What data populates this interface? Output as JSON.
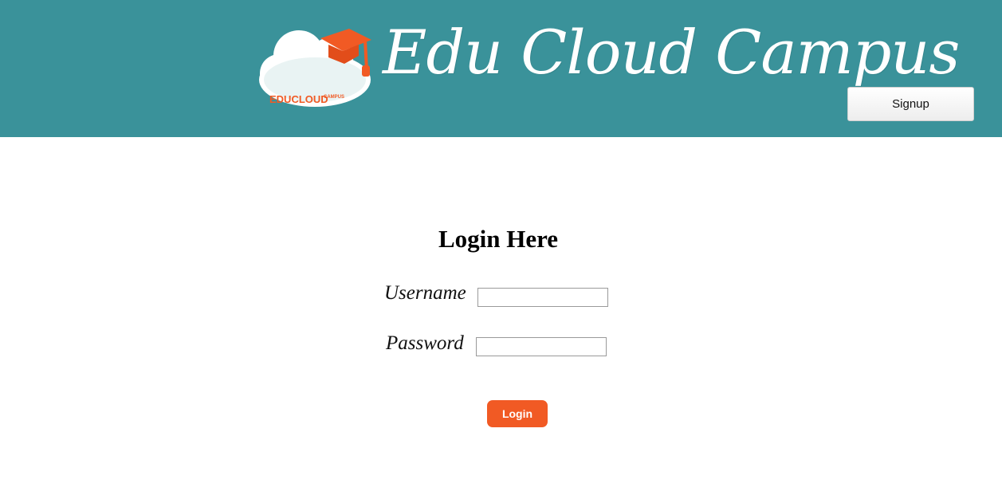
{
  "header": {
    "brand_title": "Edu Cloud Campus",
    "logo_main_text": "EDUCLOUD",
    "logo_sub_text": "CAMPUS",
    "signup_label": "Signup",
    "background_color": "#3a929a"
  },
  "login": {
    "title": "Login Here",
    "username_label": "Username",
    "username_value": "",
    "password_label": "Password",
    "password_value": "",
    "submit_label": "Login",
    "button_color": "#f15a24"
  }
}
